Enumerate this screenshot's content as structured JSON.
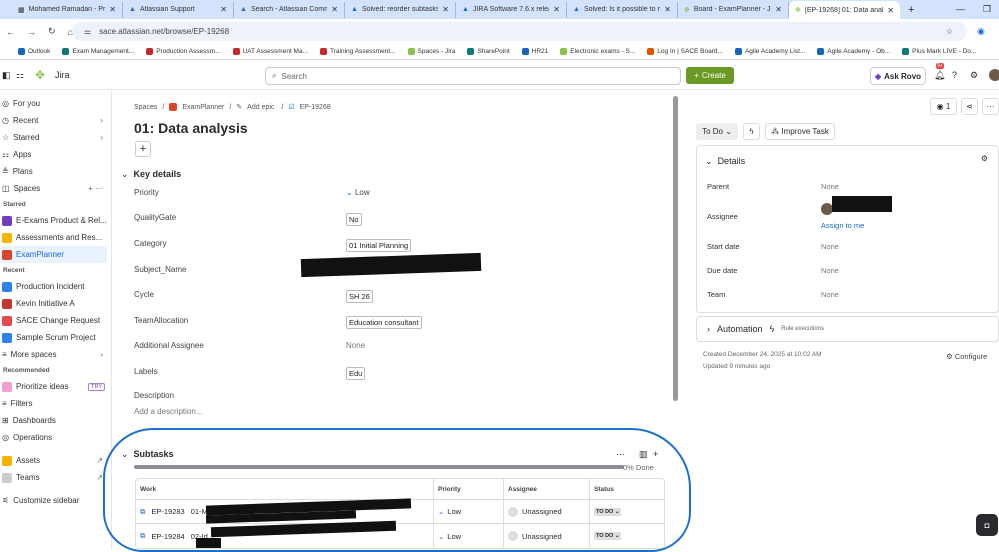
{
  "browser": {
    "tabs": [
      "Mohamed Ramadan - Pro",
      "Atlassian Support",
      "Search - Atlassian Comm",
      "Solved: reorder subtasks",
      "JIRA Software 7.6.x release",
      "Solved: Is it possible to re",
      "Board - ExamPlanner - Jira",
      "[EP-19268] 01: Data analy"
    ],
    "url": "sace.atlassian.net/browse/EP-19268",
    "bookmarks": [
      "Outlook",
      "Exam Management...",
      "Production Assessm...",
      "UAT Assessment Ma...",
      "Training Assessment...",
      "Spaces - Jira",
      "SharePoint",
      "HR21",
      "Electronic exams - S...",
      "Log In | SACE Board...",
      "Agile Academy List...",
      "Agile Academy - Ob...",
      "Plus Mark LIVE - Do..."
    ]
  },
  "header": {
    "app": "Jira",
    "search_placeholder": "Search",
    "create": "Create",
    "ask_rovo": "Ask Rovo",
    "notif_badge": "9+"
  },
  "sidebar": {
    "top": [
      "For you",
      "Recent",
      "Starred",
      "Apps",
      "Plans",
      "Spaces"
    ],
    "starred_heading": "Starred",
    "starred": [
      "E-Exams Product & Rel...",
      "Assessments and Res...",
      "ExamPlanner"
    ],
    "recent_heading": "Recent",
    "recent": [
      "Production Incident",
      "Kevin Initiative A",
      "SACE Change Request",
      "Sample Scrum Project",
      "More spaces"
    ],
    "recommended_heading": "Recommended",
    "recommended": "Prioritize ideas",
    "try": "TRY",
    "bottom": [
      "Filters",
      "Dashboards",
      "Operations",
      "Assets",
      "Teams",
      "Customize sidebar"
    ]
  },
  "issue": {
    "breadcrumb": [
      "Spaces",
      "ExamPlanner",
      "Add epic",
      "EP-19268"
    ],
    "title": "01: Data analysis",
    "key_details": "Key details",
    "fields": [
      {
        "label": "Priority",
        "value": "Low"
      },
      {
        "label": "QualityGate",
        "value": "No"
      },
      {
        "label": "Category",
        "value": "01 Initial Planning"
      },
      {
        "label": "Subject_Name",
        "value": ""
      },
      {
        "label": "Cycle",
        "value": "SH 26"
      },
      {
        "label": "TeamAllocation",
        "value": "Education consultant"
      },
      {
        "label": "Additional Assignee",
        "value": "None"
      },
      {
        "label": "Labels",
        "value": "Edu"
      }
    ],
    "description_label": "Description",
    "description_placeholder": "Add a description..."
  },
  "subtasks": {
    "title": "Subtasks",
    "progress_pct": 0,
    "progress_label": "0% Done",
    "columns": [
      "Work",
      "Priority",
      "Assignee",
      "Status"
    ],
    "rows": [
      {
        "key": "EP-19283",
        "title": "01-M",
        "priority": "Low",
        "assignee": "Unassigned",
        "status": "TO DO"
      },
      {
        "key": "EP-19284",
        "title": "02-Id",
        "priority": "Low",
        "assignee": "Unassigned",
        "status": "TO DO"
      }
    ]
  },
  "panel": {
    "watchers": "1",
    "status": "To Do",
    "improve": "Improve Task",
    "details": "Details",
    "rows": [
      {
        "label": "Parent",
        "value": "None"
      },
      {
        "label": "Assignee",
        "value": ""
      },
      {
        "label": "Start date",
        "value": "None"
      },
      {
        "label": "Due date",
        "value": "None"
      },
      {
        "label": "Team",
        "value": "None"
      }
    ],
    "assign_to_me": "Assign to me",
    "automation": "Automation",
    "rule_exec": "Rule executions",
    "created": "Created December 24, 2025 at 10:02 AM",
    "updated": "Updated 9 minutes ago",
    "configure": "Configure"
  }
}
